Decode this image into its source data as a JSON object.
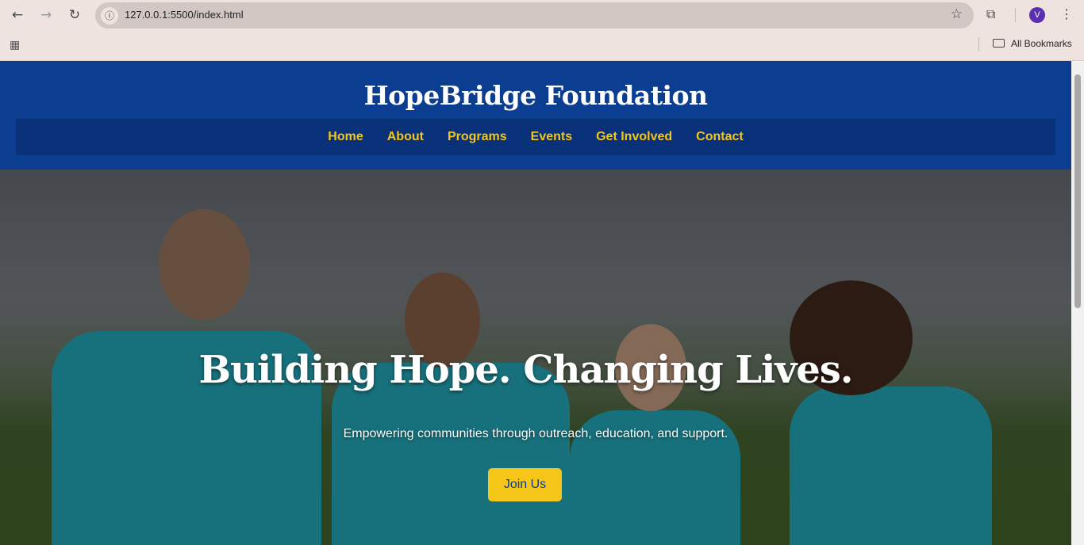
{
  "browser": {
    "url": "127.0.0.1:5500/index.html",
    "profile_initial": "V",
    "bookmarks_label": "All Bookmarks",
    "icons": [
      "back-arrow",
      "forward-arrow",
      "reload",
      "info",
      "star",
      "extensions",
      "kebab-menu",
      "apps-grid",
      "folder"
    ]
  },
  "site": {
    "title": "HopeBridge Foundation",
    "nav": [
      {
        "label": "Home"
      },
      {
        "label": "About"
      },
      {
        "label": "Programs"
      },
      {
        "label": "Events"
      },
      {
        "label": "Get Involved"
      },
      {
        "label": "Contact"
      }
    ],
    "hero": {
      "heading": "Building Hope. Changing Lives.",
      "subheading": "Empowering communities through outreach, education, and support.",
      "cta": "Join Us"
    },
    "colors": {
      "header": "#0b3d91",
      "nav_bg": "#08317a",
      "accent": "#f5c518"
    }
  }
}
